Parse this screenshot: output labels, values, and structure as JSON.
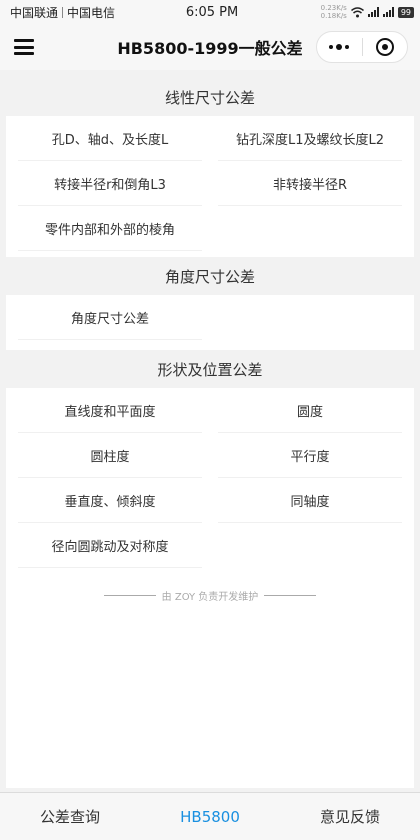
{
  "status_bar": {
    "carrier1": "中国联通",
    "carrier2": "中国电信",
    "time": "6:05 PM",
    "speed_up": "0.23K/s",
    "speed_down": "0.18K/s",
    "battery": "99"
  },
  "header": {
    "title": "HB5800-1999一般公差"
  },
  "sections": [
    {
      "title": "线性尺寸公差",
      "items": [
        "孔D、轴d、及长度L",
        "钻孔深度L1及螺纹长度L2",
        "转接半径r和倒角L3",
        "非转接半径R",
        "零件内部和外部的棱角"
      ]
    },
    {
      "title": "角度尺寸公差",
      "items": [
        "角度尺寸公差"
      ]
    },
    {
      "title": "形状及位置公差",
      "items": [
        "直线度和平面度",
        "圆度",
        "圆柱度",
        "平行度",
        "垂直度、倾斜度",
        "同轴度",
        "径向圆跳动及对称度"
      ]
    }
  ],
  "footer": {
    "credit": "由 ZOY 负责开发维护"
  },
  "tabbar": {
    "tabs": [
      "公差查询",
      "HB5800",
      "意见反馈"
    ],
    "active_color": "#1a90e0"
  }
}
